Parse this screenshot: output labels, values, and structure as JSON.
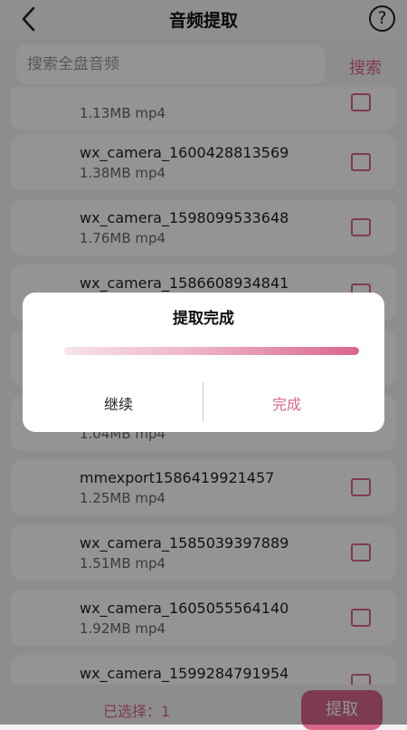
{
  "header": {
    "title": "音频提取",
    "help_label": "?"
  },
  "search": {
    "placeholder": "搜索全盘音频",
    "button_label": "搜索"
  },
  "list": {
    "items": [
      {
        "name": "",
        "size": "1.13MB",
        "format": "mp4"
      },
      {
        "name": "wx_camera_1600428813569",
        "size": "1.38MB",
        "format": "mp4"
      },
      {
        "name": "wx_camera_1598099533648",
        "size": "1.76MB",
        "format": "mp4"
      },
      {
        "name": "wx_camera_1586608934841",
        "size": "",
        "format": ""
      },
      {
        "name": "",
        "size": "",
        "format": ""
      },
      {
        "name": "",
        "size": "1.04MB",
        "format": "mp4"
      },
      {
        "name": "mmexport1586419921457",
        "size": "1.25MB",
        "format": "mp4"
      },
      {
        "name": "wx_camera_1585039397889",
        "size": "1.51MB",
        "format": "mp4"
      },
      {
        "name": "wx_camera_1605055564140",
        "size": "1.92MB",
        "format": "mp4"
      },
      {
        "name": "wx_camera_1599284791954",
        "size": "",
        "format": ""
      }
    ]
  },
  "bottom": {
    "selected_label": "已选择：",
    "selected_count": "1",
    "extract_label": "提取"
  },
  "dialog": {
    "title": "提取完成",
    "progress_fraction": 1.0,
    "continue_label": "继续",
    "done_label": "完成"
  },
  "colors": {
    "accent": "#d8678b",
    "background": "#f3f3f3",
    "card": "#ffffff"
  }
}
